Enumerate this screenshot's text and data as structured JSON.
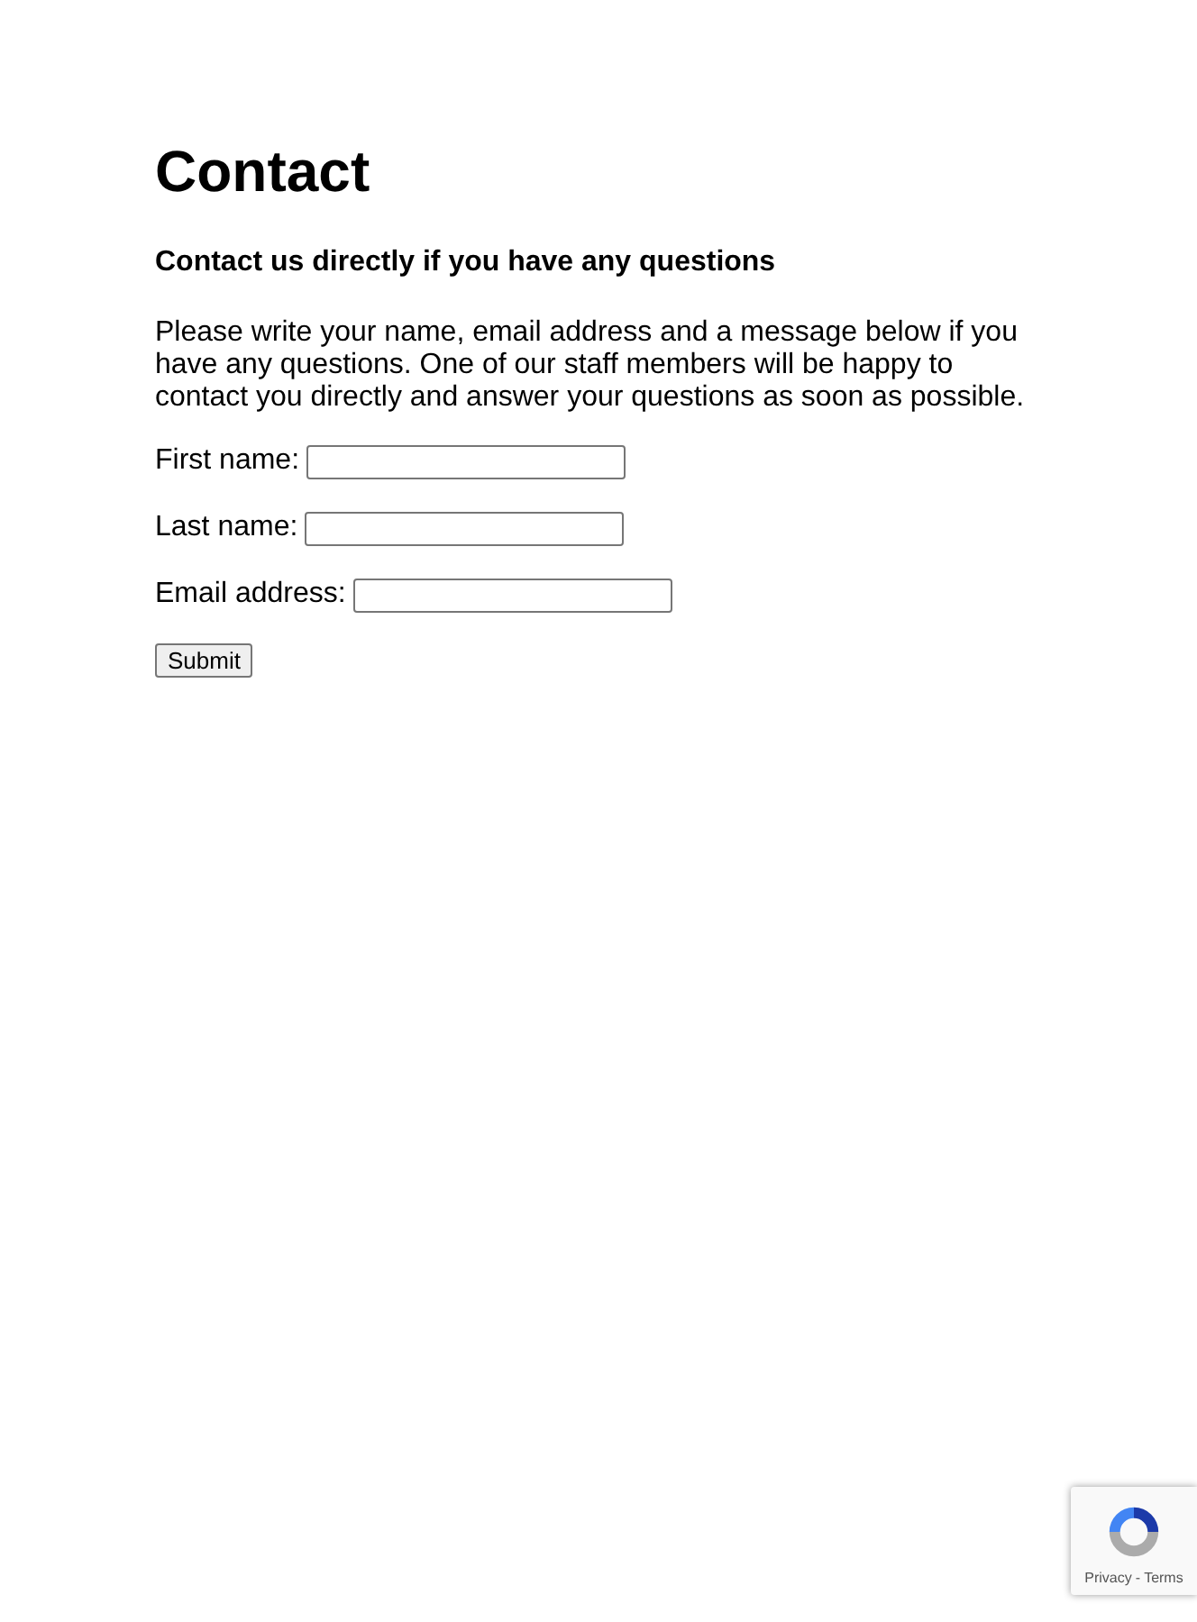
{
  "heading": "Contact",
  "subheading": "Contact us directly if you have any questions",
  "intro": "Please write your name, email address and a message below if you have any questions. One of our staff members will be happy to contact you directly and answer your questions as soon as possible.",
  "fields": [
    {
      "label": "First name:"
    },
    {
      "label": "Last name:"
    },
    {
      "label": "Email address:"
    }
  ],
  "submit": "Submit",
  "recaptcha": {
    "links": [
      "Privacy",
      "Terms"
    ],
    "separator": "-"
  }
}
